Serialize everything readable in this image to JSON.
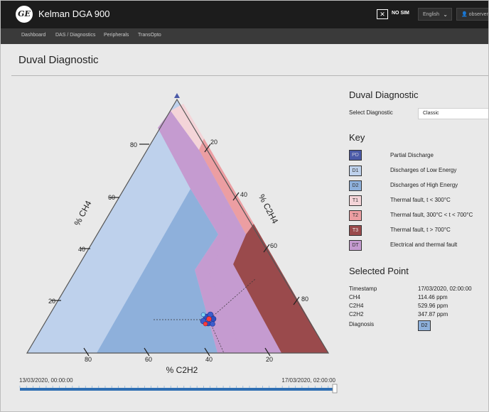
{
  "header": {
    "logo_text": "GE",
    "app_title": "Kelman DGA 900",
    "nosim_label": "NO SIM",
    "language": "English",
    "user": "observer"
  },
  "nav": {
    "items": [
      {
        "label": "Dashboard"
      },
      {
        "label": "DAS / Diagnostics"
      },
      {
        "label": "Peripherals"
      },
      {
        "label": "TransOpto"
      }
    ]
  },
  "page_title": "Duval Diagnostic",
  "triangle": {
    "left_axis": "% CH4",
    "right_axis": "% C2H4",
    "bottom_axis": "% C2H2",
    "ticks": [
      "20",
      "40",
      "60",
      "80"
    ]
  },
  "timeline": {
    "start": "13/03/2020, 00:00:00",
    "end": "17/03/2020, 02:00:00",
    "position_fraction": 1.0
  },
  "panel": {
    "title": "Duval Diagnostic",
    "select_label": "Select Diagnostic",
    "select_value": "Classic",
    "key_title": "Key",
    "key": [
      {
        "code": "PD",
        "label": "Partial Discharge",
        "color": "#4b5aa8"
      },
      {
        "code": "D1",
        "label": "Discharges of Low Energy",
        "color": "#bed1ec"
      },
      {
        "code": "D2",
        "label": "Discharges of High Energy",
        "color": "#8eb0db"
      },
      {
        "code": "T1",
        "label": "Thermal fault, t < 300°C",
        "color": "#f4d4d8"
      },
      {
        "code": "T2",
        "label": "Thermal fault, 300°C < t < 700°C",
        "color": "#ec9ea2"
      },
      {
        "code": "T3",
        "label": "Thermal fault, t > 700°C",
        "color": "#9a4a4c"
      },
      {
        "code": "DT",
        "label": "Electrical and thermal fault",
        "color": "#c59bd0"
      }
    ],
    "selected_title": "Selected Point",
    "selected": {
      "timestamp_label": "Timestamp",
      "timestamp": "17/03/2020, 02:00:00",
      "ch4_label": "CH4",
      "ch4": "114.46 ppm",
      "c2h4_label": "C2H4",
      "c2h4": "529.96 ppm",
      "c2h2_label": "C2H2",
      "c2h2": "347.87 ppm",
      "diagnosis_label": "Diagnosis",
      "diagnosis": "D2"
    }
  }
}
